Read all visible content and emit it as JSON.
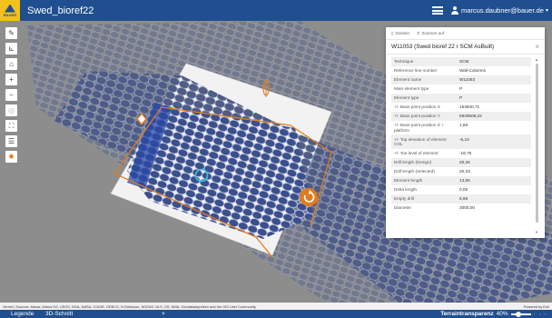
{
  "app": {
    "logo_text": "BAUER",
    "title": "Swed_bioref22",
    "user": "marcus.daubner@bauer.de"
  },
  "toolbar_icons": [
    "edit-icon",
    "measure-icon",
    "home-icon",
    "zoom-in-icon",
    "zoom-out-icon",
    "compass-icon",
    "fullscreen-icon",
    "layers-icon",
    "basemap-icon"
  ],
  "panel": {
    "toolbar": {
      "dock_label": "Dossier",
      "zoom_label": "Zoomen auf"
    },
    "title": "W11053 (Swed bioref 22 r SCM AsBuilt)",
    "attributes": [
      {
        "key": "Technique",
        "value": "SCM"
      },
      {
        "key": "Reference line number",
        "value": "Wall-Columns"
      },
      {
        "key": "Element name",
        "value": "W11053"
      },
      {
        "key": "Main element type",
        "value": "P"
      },
      {
        "key": "Element type",
        "value": "P"
      },
      {
        "key": "+/- Base point position X",
        "value": "153840,71"
      },
      {
        "key": "+/- Base point position Y",
        "value": "6929509,22"
      },
      {
        "key": "+/- Base point position Z + platform",
        "value": "1,58"
      },
      {
        "key": "+/- Top elevation of element COL",
        "value": "-5,10"
      },
      {
        "key": "+/- Toe level of element",
        "value": "-18,75"
      },
      {
        "key": "Drill length (Design)",
        "value": "20,26"
      },
      {
        "key": "Drill length (Selected)",
        "value": "20,33"
      },
      {
        "key": "Element length",
        "value": "13,65"
      },
      {
        "key": "Delta length",
        "value": "0,05"
      },
      {
        "key": "Empty drill",
        "value": "6,68"
      },
      {
        "key": "Diameter",
        "value": "3000,00"
      }
    ]
  },
  "attribution": {
    "text": "Vermit | Sources: Maxar, Airbus DS, USGS, NGA, NASA, CGIAR, GEBCO, N Robinson, NCEAS, NLS, OS, NMA, Geodatastyrelsen and the GIS User Community",
    "powered": "Powered by Esri"
  },
  "bottom": {
    "legend": "Legende",
    "schnitt": "3D-Schnitt",
    "close": "×",
    "terrain_label": "Terraintransparenz",
    "terrain_value": "40%",
    "terrain_fraction": 0.4,
    "dots": "· · ·"
  },
  "colors": {
    "header": "#1f4f8f",
    "logo": "#f3c11b",
    "accent": "#e07c1e",
    "piles": "#3b4f8c",
    "selected": "#35c6e0"
  }
}
